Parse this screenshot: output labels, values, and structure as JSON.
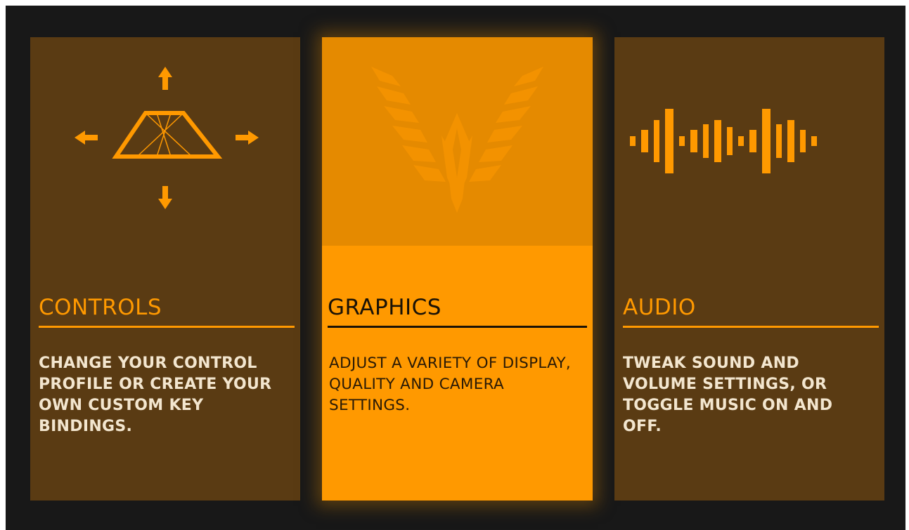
{
  "colors": {
    "accent": "#ff9900",
    "card_bg": "#5a3b13",
    "frame_bg": "#181818",
    "active_icon_bg": "#e58a00"
  },
  "cards": [
    {
      "title": "CONTROLS",
      "description": "CHANGE YOUR CONTROL PROFILE OR CREATE YOUR OWN CUSTOM KEY BINDINGS.",
      "icon": "controls-arrows-icon",
      "selected": false
    },
    {
      "title": "GRAPHICS",
      "description": "ADJUST A VARIETY OF DISPLAY, QUALITY AND CAMERA SETTINGS.",
      "icon": "eagle-emblem-icon",
      "selected": true
    },
    {
      "title": "AUDIO",
      "description": "TWEAK SOUND AND VOLUME SETTINGS, OR TOGGLE MUSIC ON AND OFF.",
      "icon": "audio-waveform-icon",
      "selected": false
    }
  ]
}
